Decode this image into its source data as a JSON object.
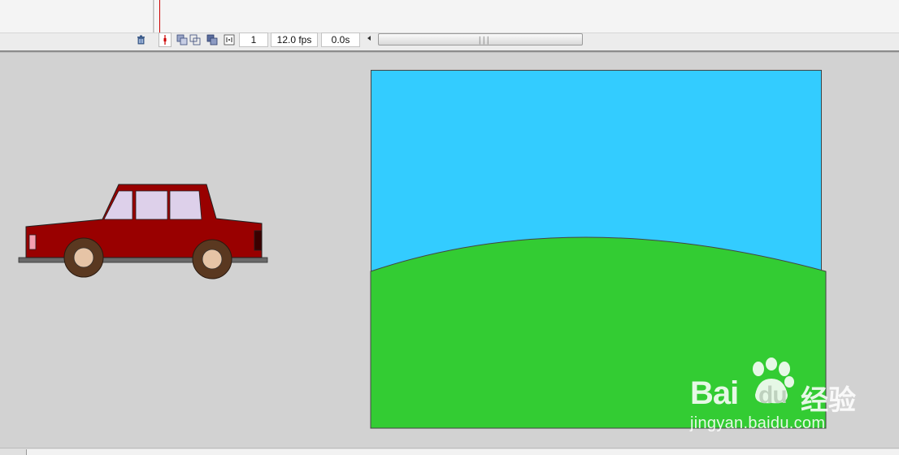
{
  "timeline": {
    "frame_number": "1",
    "frame_rate": "12.0 fps",
    "elapsed_time": "0.0s"
  },
  "icons": {
    "delete_layer": "trash-icon",
    "center_frame": "center-frame-icon",
    "onion_skin": "onion-skin-icon",
    "onion_skin_outlines": "onion-skin-outlines-icon",
    "edit_multiple_frames": "edit-multiple-frames-icon",
    "modify_onion_markers": "modify-onion-markers-icon"
  },
  "stage": {
    "sky_color": "#33ccff",
    "ground_color": "#33cc33",
    "car_body_color": "#990000",
    "car_window_color": "#ddd0ea",
    "wheel_color": "#5a3820",
    "hubcap_color": "#e6c4a6"
  },
  "watermark": {
    "brand": "Bai",
    "brand_du": "du",
    "suffix": "经验",
    "url": "jingyan.baidu.com"
  }
}
